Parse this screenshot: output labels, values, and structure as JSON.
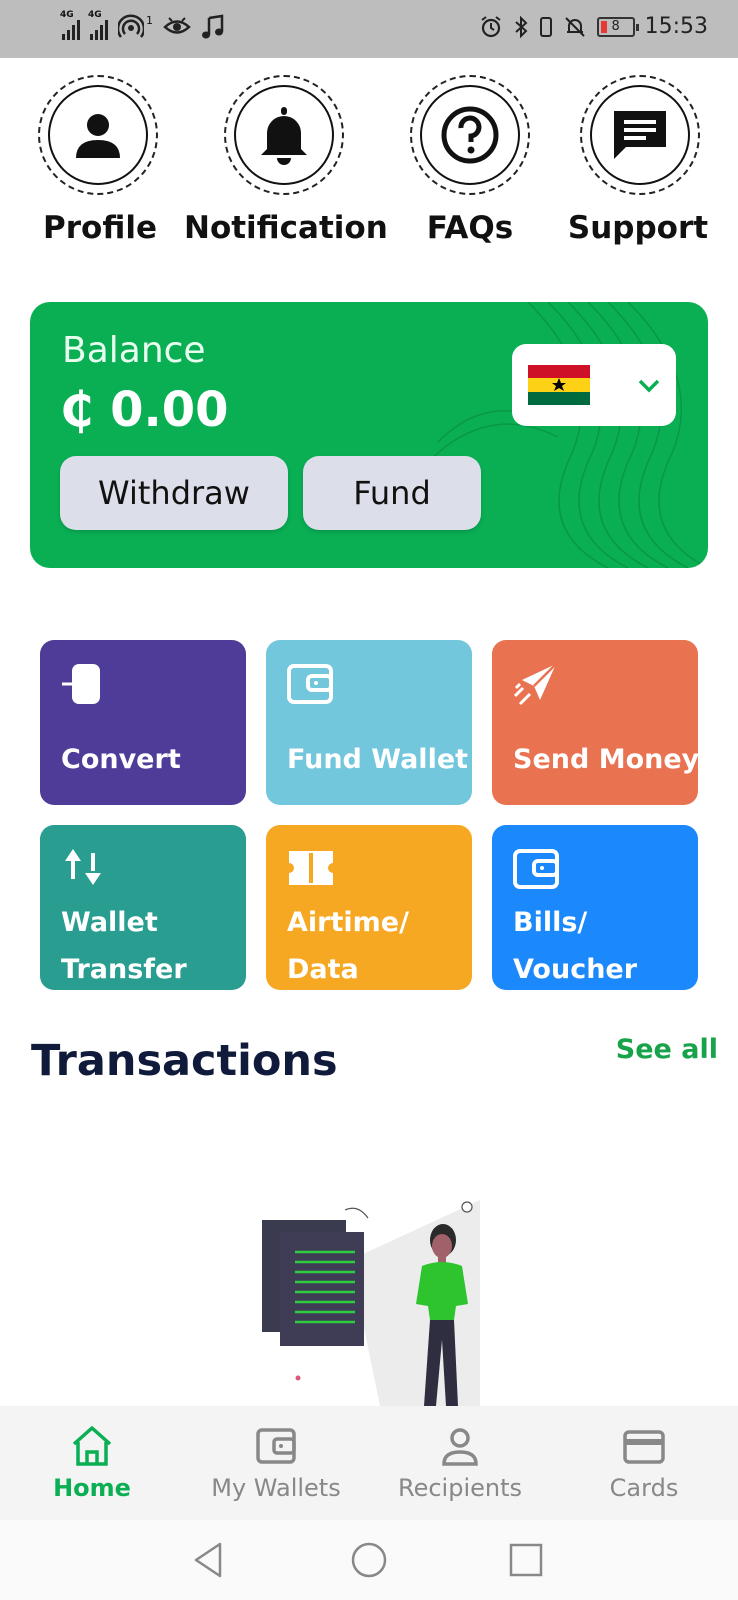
{
  "status_bar": {
    "network_1": "4G",
    "network_2": "4G",
    "notification_count": "1",
    "battery_level": "8",
    "time": "15:53"
  },
  "quick_links": [
    {
      "label": "Profile",
      "icon": "person-icon"
    },
    {
      "label": "Notification",
      "icon": "bell-icon"
    },
    {
      "label": "FAQs",
      "icon": "question-icon"
    },
    {
      "label": "Support",
      "icon": "chat-icon"
    }
  ],
  "balance": {
    "label": "Balance",
    "amount": "₵ 0.00",
    "withdraw_label": "Withdraw",
    "fund_label": "Fund",
    "currency_flag": "ghana-flag-icon"
  },
  "actions": [
    {
      "label": "Convert",
      "color": "#4f3c99",
      "icon": "convert-icon"
    },
    {
      "label": "Fund Wallet",
      "color": "#72c7dc",
      "icon": "wallet-icon"
    },
    {
      "label": "Send Money",
      "color": "#e97251",
      "icon": "paper-plane-icon"
    },
    {
      "label_line1": "Wallet",
      "label_line2": "Transfer",
      "color": "#289d90",
      "icon": "transfer-arrows-icon"
    },
    {
      "label_line1": "Airtime/",
      "label_line2": "Data",
      "color": "#f6a822",
      "icon": "ticket-icon"
    },
    {
      "label_line1": "Bills/",
      "label_line2": "Voucher",
      "color": "#1b88fb",
      "icon": "wallet-icon"
    }
  ],
  "transactions": {
    "title": "Transactions",
    "see_all": "See all"
  },
  "bottom_nav": [
    {
      "label": "Home",
      "icon": "home-icon",
      "active": true
    },
    {
      "label": "My Wallets",
      "icon": "wallet-icon",
      "active": false
    },
    {
      "label": "Recipients",
      "icon": "person-icon",
      "active": false
    },
    {
      "label": "Cards",
      "icon": "card-icon",
      "active": false
    }
  ],
  "colors": {
    "brand_green": "#0aaf54",
    "title_navy": "#101a3a"
  }
}
